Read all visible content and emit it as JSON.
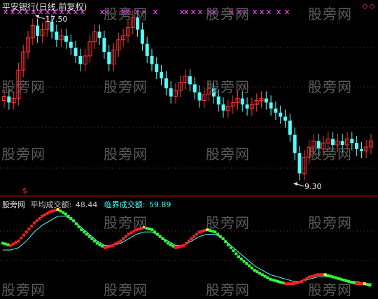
{
  "window": {
    "title": "平安银行(日线,前复权)",
    "top_right_icons": "◇◇"
  },
  "watermark": {
    "text": "股旁网"
  },
  "main_chart": {
    "high_label": "17.50",
    "low_label": "9.30",
    "dollar_marker": "$",
    "colors": {
      "up": "#ff3232",
      "down": "#54ffff",
      "x_marks": "#ff40ff",
      "dots": "#8a2a2a",
      "separator": "#cc0000"
    }
  },
  "sub_chart": {
    "brand": "股旁网",
    "avg_label": "平均成交额:",
    "avg_value": "48.44",
    "critical_label": "临界成交额:",
    "critical_value": "59.89",
    "colors": {
      "brand": "#e0e0e0",
      "avg_label": "#c8c8c8",
      "avg_value": "#c8c8c8",
      "critical": "#54ffff",
      "rise": "#ff2020",
      "fall": "#30ff30",
      "peak": "#ffff40",
      "line": "#54ffff"
    }
  },
  "chart_data": [
    {
      "type": "candlestick",
      "title": "平安银行(日线,前复权)",
      "annotations": [
        {
          "label": "17.50",
          "kind": "period-high"
        },
        {
          "label": "9.30",
          "kind": "period-low"
        }
      ],
      "close": [
        13.6,
        13.3,
        13.5,
        14.9,
        15.8,
        16.5,
        17.1,
        16.6,
        16.9,
        17.3,
        16.8,
        16.4,
        16.6,
        16.3,
        16.0,
        15.6,
        15.2,
        15.6,
        16.3,
        16.8,
        16.5,
        15.8,
        15.2,
        15.9,
        16.4,
        16.6,
        17.0,
        17.5,
        16.9,
        16.2,
        15.6,
        15.2,
        14.8,
        14.5,
        14.0,
        13.6,
        13.9,
        14.3,
        14.6,
        14.2,
        13.8,
        13.4,
        13.7,
        14.0,
        13.6,
        13.2,
        12.9,
        13.1,
        13.3,
        13.5,
        13.2,
        13.0,
        13.2,
        13.4,
        13.5,
        13.3,
        13.0,
        12.8,
        12.6,
        12.4,
        11.7,
        10.8,
        9.8,
        10.6,
        11.1,
        11.4,
        11.0,
        11.3,
        11.5,
        11.2,
        11.4,
        11.2,
        11.5,
        11.3,
        11.0,
        10.9,
        11.1,
        11.4
      ]
    },
    {
      "type": "line",
      "series": [
        {
          "name": "平均成交额",
          "values": [
            22,
            21,
            23,
            27,
            31,
            34,
            36,
            37,
            35,
            32,
            28,
            25,
            22,
            20,
            21,
            23,
            26,
            28,
            29,
            28,
            25,
            22,
            20,
            21,
            24,
            27,
            28,
            27,
            24,
            20,
            16,
            13,
            10,
            8,
            6,
            5,
            4,
            4,
            5,
            7,
            8,
            8,
            7,
            6,
            5,
            4,
            4,
            3
          ]
        },
        {
          "name": "临界成交额",
          "values": [
            19,
            19,
            20,
            23,
            27,
            30,
            32,
            34,
            34,
            32,
            29,
            26,
            23,
            21,
            21,
            22,
            24,
            26,
            27,
            27,
            25,
            23,
            21,
            21,
            23,
            25,
            26,
            26,
            24,
            21,
            18,
            15,
            12,
            10,
            8,
            7,
            6,
            5,
            5,
            6,
            7,
            7,
            7,
            6,
            5,
            5,
            4,
            4
          ]
        }
      ]
    }
  ]
}
